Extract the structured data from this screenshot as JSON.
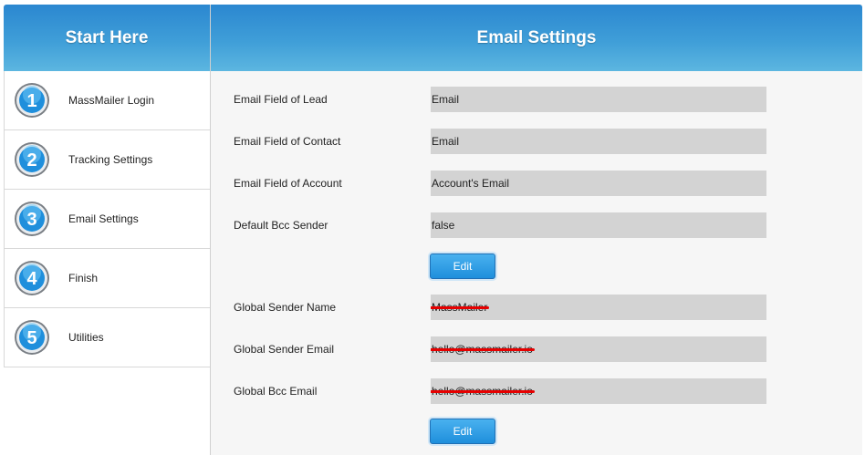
{
  "sidebar": {
    "title": "Start Here",
    "items": [
      {
        "number": "1",
        "label": "MassMailer Login"
      },
      {
        "number": "2",
        "label": "Tracking Settings"
      },
      {
        "number": "3",
        "label": "Email Settings"
      },
      {
        "number": "4",
        "label": "Finish"
      },
      {
        "number": "5",
        "label": "Utilities"
      }
    ]
  },
  "main": {
    "title": "Email Settings",
    "fields": [
      {
        "label": "Email Field of Lead",
        "value": "Email"
      },
      {
        "label": "Email Field of Contact",
        "value": "Email"
      },
      {
        "label": "Email Field of Account",
        "value": "Account's Email"
      },
      {
        "label": "Default Bcc Sender",
        "value": "false"
      }
    ],
    "edit_button_1": "Edit",
    "sender_fields": [
      {
        "label": "Global Sender Name",
        "value": "MassMailer"
      },
      {
        "label": "Global Sender Email",
        "value": "hello@massmailer.io"
      },
      {
        "label": "Global Bcc Email",
        "value": "hello@massmailer.io"
      }
    ],
    "edit_button_2": "Edit"
  },
  "colors": {
    "header_blue": "#3f9ed8",
    "field_gray": "#d3d3d3",
    "redaction_red": "#e60000",
    "button_blue": "#1f8fdc"
  }
}
